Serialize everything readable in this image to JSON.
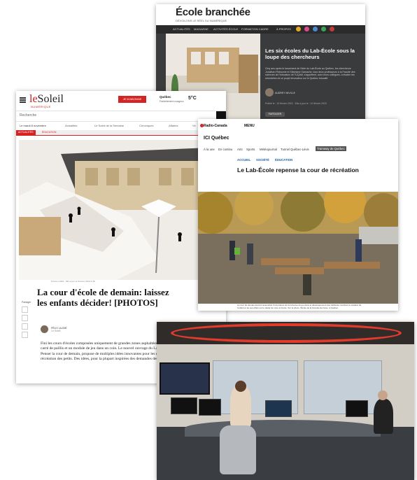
{
  "ecole_branchee": {
    "logo": "École branchée",
    "tagline": "DÉVOILONS LE RÉEL DU NUMÉRIQUE",
    "nav": [
      "ACTUALITÉS",
      "MAGAZINE",
      "ACTIVITÉS ÉCOLE",
      "FORMATION CADRE",
      "À PROPOS"
    ],
    "title": "Les six écoles du Lab-École sous la loupe des chercheurs",
    "body": "Cinq ans après le lancement de l'idée du Lab-École au Québec, les chercheurs Jonathan Rhéaume et Stéphane Gamache, tous deux professeurs à la Faculté des sciences de l'éducation de l'UQAM, s'apprêtent, avec leurs collègues, à étudier les retombées de ce projet innovateur sur le Québec éducatif.",
    "author": "AUDREY MIVILLE",
    "date": "Publié le : 10 février 2022 · Mis à jour le : 10 février 2022",
    "share": "PARTAGER"
  },
  "le_soleil": {
    "brand_prefix": "le",
    "brand_main": "Soleil",
    "brand_sub": "NUMÉRIQUE",
    "subscribe": "JE M'ABONNE",
    "city": "Québec",
    "conditions": "Partiellement nuageux",
    "temp": "5°C",
    "search_placeholder": "Recherche",
    "date": "Le mardi 8 novembre",
    "sections": [
      "Actualités",
      "Le Soleil de la Semaine",
      "Chroniques",
      "Affaires",
      "Vir"
    ],
    "tabs": [
      "ACTUALITÉS",
      "ÉDUCATION"
    ],
    "meta": "8 février 2022 · Mis à jour le 8 février 2022 à 6h",
    "title": "La cour d'école de demain: laissez les enfants décider! [PHOTOS]",
    "share_label": "Partager",
    "author": "FÉLIX LAJOIE",
    "author_org": "Le Soleil",
    "lede": "Fini les cours d'écoles composées uniquement de grandes zones asphaltées avec un carré de paillis et un module de jeu dans un coin. Le nouvel ouvrage du Lab-École, Penser la cour de demain, propose de multiples idées innovantes pour les espaces de récréation des petits. Des idées, pour la plupart inspirées des demandes des enfants!"
  },
  "radio_canada": {
    "logo": "Radio-Canada",
    "menu": "MENU",
    "region": "ICI Québec",
    "subnav": [
      "À la une",
      "En continu",
      "Arts",
      "Sports",
      "Météojournal",
      "Tunnel Québec-Lévis",
      "Tramway de Québec"
    ],
    "categories": [
      "ACCUEIL",
      "SOCIÉTÉ",
      "ÉDUCATION"
    ],
    "title": "Le Lab-École repense la cour de récréation",
    "caption": "La cour de demain devrait rassembler l'importance de la richesse du jeu dans le développement des habiletés motrices et sociales de l'enfant et de ses effets sur le plaisir de vivre à l'école. Sur la photo, l'École de la Grande-Hermine, à Québec."
  },
  "colors": {
    "soleil_red": "#d32323",
    "rc_blue": "#1b62a6",
    "studio_red": "#e23b2b"
  }
}
